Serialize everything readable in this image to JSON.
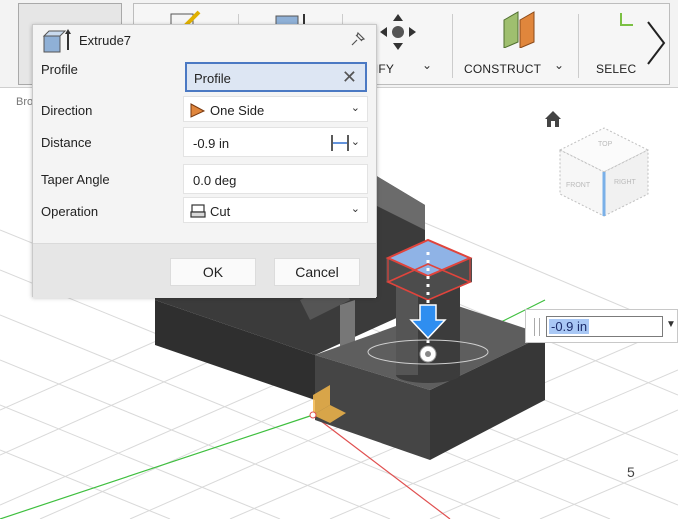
{
  "toolbar": {
    "modify_label": "DIFY",
    "construct_label": "CONSTRUCT",
    "select_label": "SELEC",
    "left_label": "Bro"
  },
  "dialog": {
    "title": "Extrude7",
    "rows": {
      "profile": {
        "label": "Profile",
        "value": "Profile"
      },
      "direction": {
        "label": "Direction",
        "value": "One Side"
      },
      "distance": {
        "label": "Distance",
        "value": "-0.9 in"
      },
      "taper": {
        "label": "Taper Angle",
        "value": "0.0 deg"
      },
      "operation": {
        "label": "Operation",
        "value": "Cut"
      }
    },
    "ok_label": "OK",
    "cancel_label": "Cancel"
  },
  "canvas_distance_input": {
    "value": "-0.9 in"
  },
  "viewcube": {
    "top": "TOP",
    "front": "FRONT",
    "right": "RIGHT"
  },
  "page_number": "5",
  "colors": {
    "accent_blue": "#4b79c3",
    "profile_highlight": "#8fb3e6",
    "profile_edge": "#e0443c",
    "body_dark": "#4a4a4a",
    "grid_line": "#d7d7d7",
    "axis_green": "#3fbf3f",
    "axis_red": "#e05050"
  },
  "icons": {
    "extrude": "extrude-icon",
    "pin": "pin-icon",
    "direction": "one-side-direction-icon",
    "operation": "cut-icon",
    "distance_type": "distance-measure-icon",
    "home": "home-icon",
    "move": "move-icon",
    "construct": "construct-plane-icon",
    "select": "select-icon",
    "next": "chevron-right-icon"
  }
}
